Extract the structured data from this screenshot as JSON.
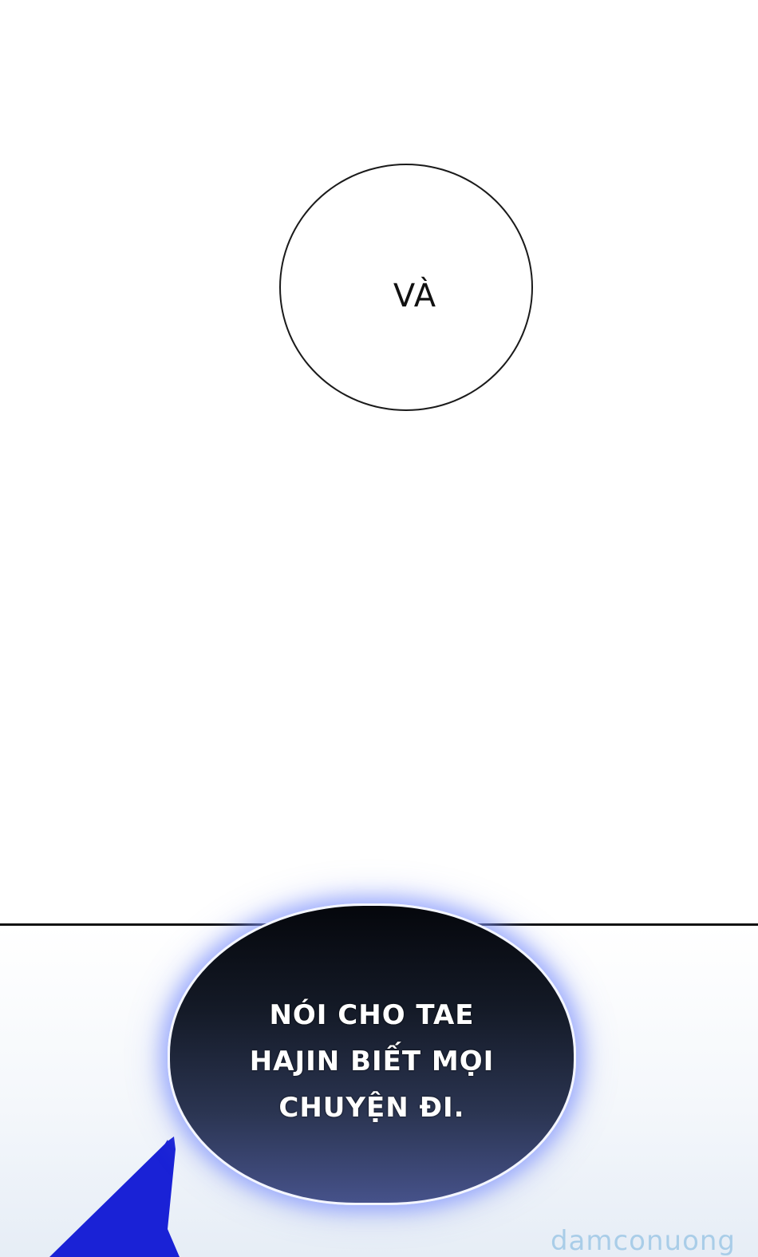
{
  "panel1": {
    "bubble_text": "VÀ"
  },
  "panel2": {
    "bubble_lines": [
      "NÓI CHO TAE",
      "HAJIN BIẾT MỌI",
      "CHUYỆN ĐI."
    ],
    "stroke_color": "#1a22d6",
    "glow_color": "#8296ff"
  },
  "watermark": {
    "text": "damconuong",
    "color": "#a9cde8"
  }
}
